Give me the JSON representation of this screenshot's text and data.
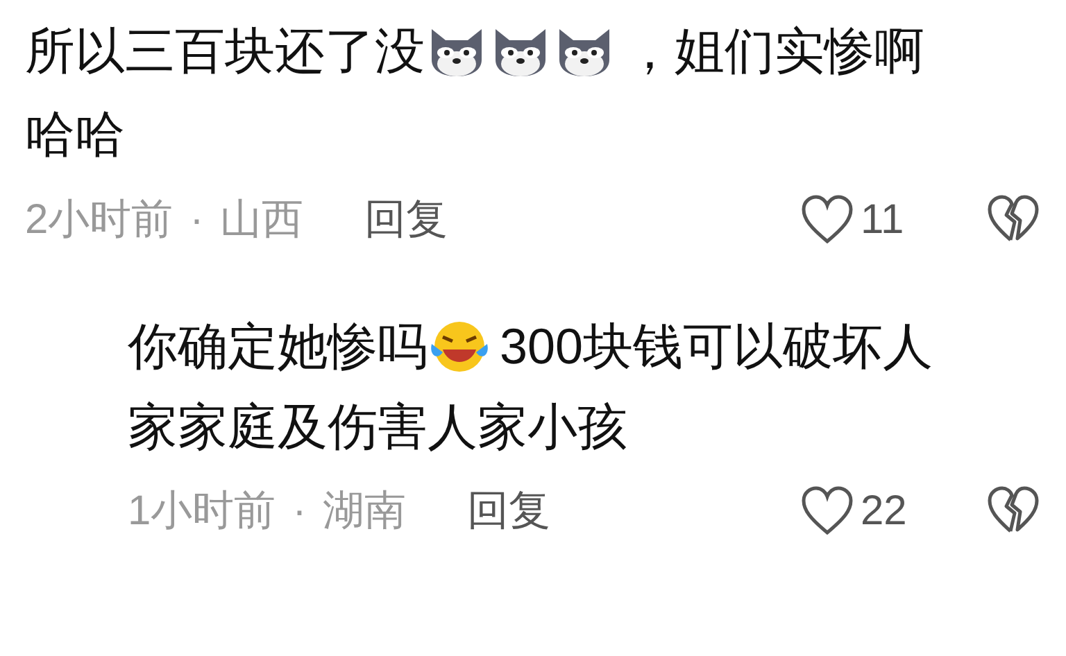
{
  "comments": [
    {
      "lines": [
        [
          {
            "kind": "text",
            "text": "所以三百块还了没"
          },
          {
            "kind": "wolf"
          },
          {
            "kind": "wolf"
          },
          {
            "kind": "wolf"
          },
          {
            "kind": "text",
            "text": "，姐们实惨啊"
          }
        ],
        [
          {
            "kind": "text",
            "text": "哈哈"
          }
        ]
      ],
      "time": "2小时前",
      "separator": "·",
      "location": "山西",
      "reply_label": "回复",
      "likes": "11",
      "replies": [
        {
          "lines": [
            [
              {
                "kind": "text",
                "text": "你确定她惨吗"
              },
              {
                "kind": "laugh-cry"
              },
              {
                "kind": "text",
                "text": "300块钱可以破坏人"
              }
            ],
            [
              {
                "kind": "text",
                "text": "家家庭及伤害人家小孩"
              }
            ]
          ],
          "time": "1小时前",
          "separator": "·",
          "location": "湖南",
          "reply_label": "回复",
          "likes": "22"
        }
      ]
    }
  ]
}
